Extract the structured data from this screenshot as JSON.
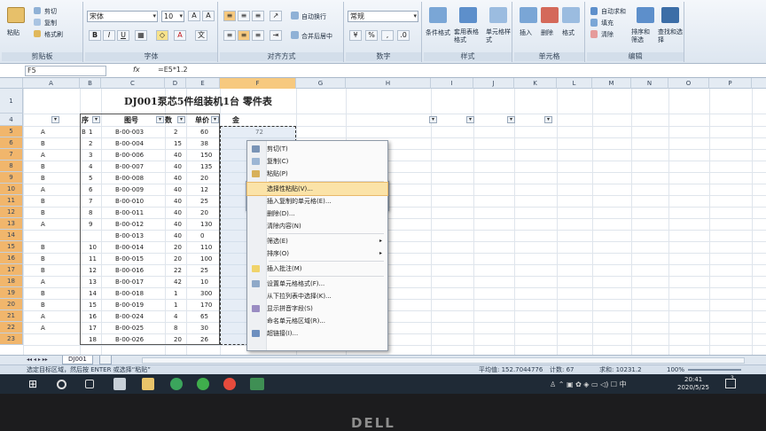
{
  "ribbon": {
    "clipboard": {
      "cut": "剪切",
      "copy": "复制",
      "format_painter": "格式刷",
      "paste": "粘贴",
      "label": "剪贴板"
    },
    "font": {
      "name": "宋体",
      "size": "10",
      "bold": "B",
      "italic": "I",
      "underline": "U",
      "label": "字体"
    },
    "align": {
      "wrap": "自动换行",
      "merge": "合并后居中",
      "label": "对齐方式"
    },
    "number": {
      "format": "常规",
      "label": "数字"
    },
    "styles": {
      "cond": "条件格式",
      "table": "套用表格格式",
      "cellstyle": "单元格样式",
      "label": "样式"
    },
    "cells": {
      "insert": "插入",
      "delete": "删除",
      "format": "格式",
      "label": "单元格"
    },
    "edit": {
      "autosum": "自动求和",
      "fill": "填充",
      "clear": "清除",
      "sort": "排序和筛选",
      "find": "查找和选择",
      "label": "编辑"
    }
  },
  "formula_bar": {
    "name_box": "F5",
    "fx": "fx",
    "formula": "=E5*1.2"
  },
  "columns": [
    "A",
    "B",
    "C",
    "D",
    "E",
    "F",
    "G",
    "H",
    "I",
    "J",
    "K",
    "L",
    "M",
    "N",
    "O",
    "P"
  ],
  "title": "DJ001泵芯5件组装机1台  零件表",
  "headers": {
    "seq": "序",
    "drawing": "图号",
    "qty": "数",
    "price": "单价",
    "amount": "金"
  },
  "rows": [
    {
      "n": "5",
      "a": "A",
      "b": "B",
      "seq": "1",
      "code": "B-00-003",
      "qty": "2",
      "price": "60",
      "f": "72"
    },
    {
      "n": "6",
      "a": "B",
      "b": "",
      "seq": "2",
      "code": "B-00-004",
      "qty": "15",
      "price": "38",
      "f": ""
    },
    {
      "n": "7",
      "a": "A",
      "b": "",
      "seq": "3",
      "code": "B-00-006",
      "qty": "40",
      "price": "150",
      "f": ""
    },
    {
      "n": "8",
      "a": "B",
      "b": "",
      "seq": "4",
      "code": "B-00-007",
      "qty": "40",
      "price": "135",
      "f": ""
    },
    {
      "n": "9",
      "a": "B",
      "b": "",
      "seq": "5",
      "code": "B-00-008",
      "qty": "40",
      "price": "20",
      "f": ""
    },
    {
      "n": "10",
      "a": "A",
      "b": "",
      "seq": "6",
      "code": "B-00-009",
      "qty": "40",
      "price": "12",
      "f": ""
    },
    {
      "n": "11",
      "a": "B",
      "b": "",
      "seq": "7",
      "code": "B-00-010",
      "qty": "40",
      "price": "25",
      "f": ""
    },
    {
      "n": "12",
      "a": "B",
      "b": "",
      "seq": "8",
      "code": "B-00-011",
      "qty": "40",
      "price": "20",
      "f": ""
    },
    {
      "n": "13",
      "a": "A",
      "b": "",
      "seq": "9",
      "code": "B-00-012",
      "qty": "40",
      "price": "130",
      "f": ""
    },
    {
      "n": "14",
      "a": "",
      "b": "",
      "seq": "",
      "code": "B-00-013",
      "qty": "40",
      "price": "0",
      "f": ""
    },
    {
      "n": "15",
      "a": "B",
      "b": "",
      "seq": "10",
      "code": "B-00-014",
      "qty": "20",
      "price": "110",
      "f": ""
    },
    {
      "n": "16",
      "a": "B",
      "b": "",
      "seq": "11",
      "code": "B-00-015",
      "qty": "20",
      "price": "100",
      "f": ""
    },
    {
      "n": "17",
      "a": "B",
      "b": "",
      "seq": "12",
      "code": "B-00-016",
      "qty": "22",
      "price": "25",
      "f": ""
    },
    {
      "n": "18",
      "a": "A",
      "b": "",
      "seq": "13",
      "code": "B-00-017",
      "qty": "42",
      "price": "10",
      "f": ""
    },
    {
      "n": "19",
      "a": "B",
      "b": "",
      "seq": "14",
      "code": "B-00-018",
      "qty": "1",
      "price": "300",
      "f": ""
    },
    {
      "n": "20",
      "a": "B",
      "b": "",
      "seq": "15",
      "code": "B-00-019",
      "qty": "1",
      "price": "170",
      "f": ""
    },
    {
      "n": "21",
      "a": "A",
      "b": "",
      "seq": "16",
      "code": "B-00-024",
      "qty": "4",
      "price": "65",
      "f": ""
    },
    {
      "n": "22",
      "a": "A",
      "b": "",
      "seq": "17",
      "code": "B-00-025",
      "qty": "8",
      "price": "30",
      "f": ""
    },
    {
      "n": "23",
      "a": "",
      "b": "",
      "seq": "18",
      "code": "B-00-026",
      "qty": "20",
      "price": "26",
      "f": ""
    }
  ],
  "mini_toolbar": {
    "font": "宋体",
    "size": "10"
  },
  "context_menu": {
    "items": [
      {
        "label": "剪切(T)",
        "icon": "scissors-icon"
      },
      {
        "label": "复制(C)",
        "icon": "copy-icon"
      },
      {
        "label": "粘贴(P)",
        "icon": "paste-icon"
      },
      {
        "label": "选择性粘贴(V)...",
        "icon": ""
      },
      {
        "label": "插入复制的单元格(E)...",
        "icon": ""
      },
      {
        "label": "删除(D)...",
        "icon": ""
      },
      {
        "label": "清除内容(N)",
        "icon": ""
      },
      {
        "label": "筛选(E)",
        "icon": "",
        "arrow": true
      },
      {
        "label": "排序(O)",
        "icon": "",
        "arrow": true
      },
      {
        "label": "插入批注(M)",
        "icon": "comment-icon"
      },
      {
        "label": "设置单元格格式(F)...",
        "icon": "format-cells-icon"
      },
      {
        "label": "从下拉列表中选择(K)...",
        "icon": ""
      },
      {
        "label": "显示拼音字段(S)",
        "icon": "phonetic-icon"
      },
      {
        "label": "命名单元格区域(R)...",
        "icon": ""
      },
      {
        "label": "超链接(I)...",
        "icon": "hyperlink-icon"
      }
    ]
  },
  "sheet_tab": "DJ001",
  "status": {
    "message": "选定目标区域，然后按 ENTER 或选择“粘贴”",
    "average": "平均值: 152.7044776",
    "count": "计数: 67",
    "sum": "求和: 10231.2",
    "zoom": "100%"
  },
  "taskbar": {
    "time": "20:41",
    "date": "2020/5/25",
    "notif": "3"
  },
  "brand": "DELL",
  "colors": {
    "accent": "#f1b66c",
    "highlight": "#fbe3a8",
    "taskbar": "#1f2a36"
  }
}
